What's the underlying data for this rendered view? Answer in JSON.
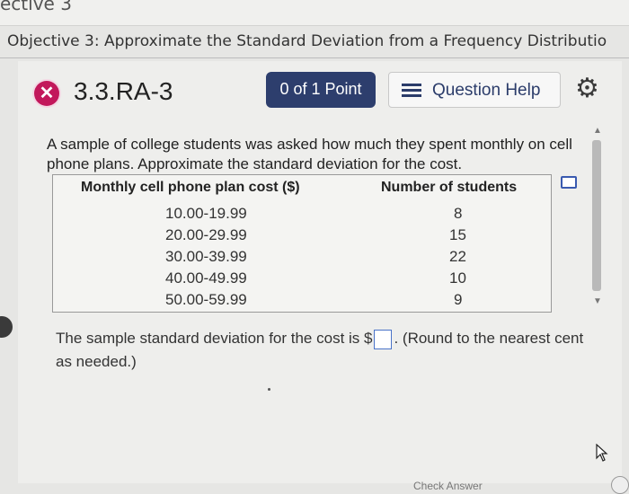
{
  "header": {
    "fragment": "ective 3",
    "objective": "Objective 3: Approximate the Standard Deviation from a Frequency Distributio"
  },
  "question": {
    "status_icon": "x-circle-icon",
    "id": "3.3.RA-3",
    "points": "0 of 1 Point",
    "help_label": "Question Help",
    "help_icon": "list-icon",
    "settings_icon": "gear-icon"
  },
  "prompt": "A sample of college students was asked how much they spent monthly on cell phone plans. Approximate the standard deviation for the cost.",
  "table": {
    "headers": [
      "Monthly cell phone plan cost ($)",
      "Number of students"
    ],
    "rows": [
      [
        "10.00-19.99",
        "8"
      ],
      [
        "20.00-29.99",
        "15"
      ],
      [
        "30.00-39.99",
        "22"
      ],
      [
        "40.00-49.99",
        "10"
      ],
      [
        "50.00-59.99",
        "9"
      ]
    ]
  },
  "answer": {
    "before": "The sample standard deviation for the cost is $",
    "after": ". (Round to the nearest cent as needed.)"
  },
  "footer": {
    "fragment": "Check Answer"
  }
}
